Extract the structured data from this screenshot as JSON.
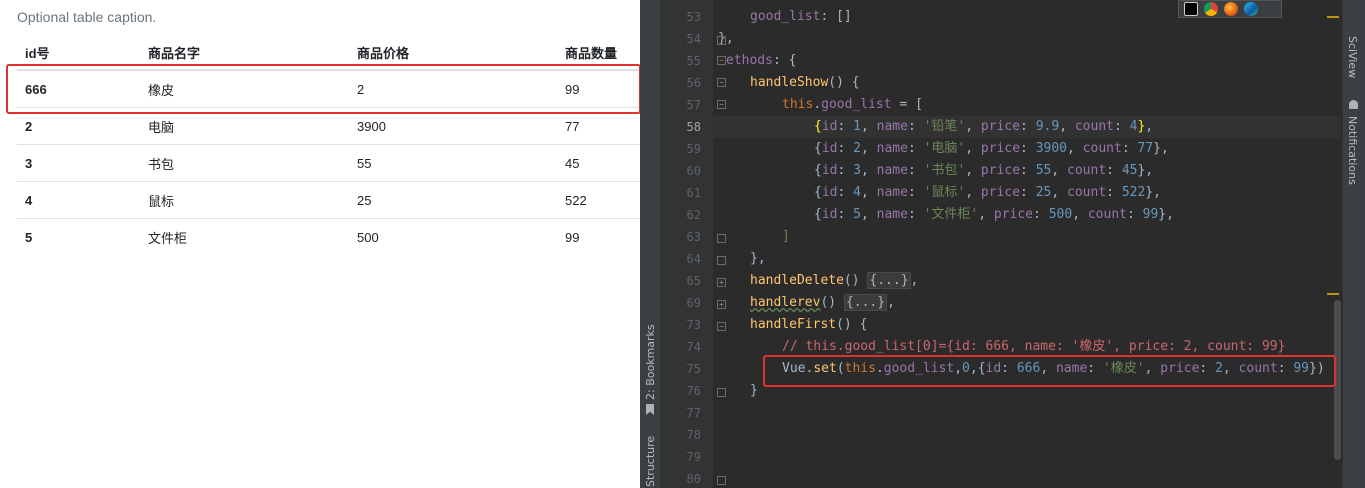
{
  "browser": {
    "caption": "Optional table caption.",
    "headers": [
      "id号",
      "商品名字",
      "商品价格",
      "商品数量"
    ],
    "rows": [
      {
        "id": "666",
        "name": "橡皮",
        "price": "2",
        "count": "99"
      },
      {
        "id": "2",
        "name": "电脑",
        "price": "3900",
        "count": "77"
      },
      {
        "id": "3",
        "name": "书包",
        "price": "55",
        "count": "45"
      },
      {
        "id": "4",
        "name": "鼠标",
        "price": "25",
        "count": "522"
      },
      {
        "id": "5",
        "name": "文件柜",
        "price": "500",
        "count": "99"
      }
    ]
  },
  "ide": {
    "left_tabs": {
      "bookmarks": "2: Bookmarks",
      "structure": "Structure"
    },
    "right_tabs": {
      "sciview": "SciView",
      "notifications": "Notifications"
    },
    "browser_icons": [
      "pycharm-icon",
      "chrome-icon",
      "firefox-icon",
      "edge-icon"
    ],
    "line_numbers": [
      "53",
      "54",
      "55",
      "56",
      "57",
      "58",
      "59",
      "60",
      "61",
      "62",
      "63",
      "64",
      "65",
      "69",
      "73",
      "74",
      "75",
      "76",
      "77",
      "78",
      "79",
      "80"
    ],
    "code": {
      "l53": [
        "good_list",
        ": []"
      ],
      "l54": [
        "},"
      ],
      "l55": [
        "ethods",
        ": {"
      ],
      "l56": [
        "handleShow",
        "() {"
      ],
      "l57": [
        "this",
        ".",
        "good_list",
        " = ["
      ],
      "items": [
        {
          "id": "1",
          "name": "'铅笔'",
          "price": "9.9",
          "count": "4"
        },
        {
          "id": "2",
          "name": "'电脑'",
          "price": "3900",
          "count": "77"
        },
        {
          "id": "3",
          "name": "'书包'",
          "price": "55",
          "count": "45"
        },
        {
          "id": "4",
          "name": "'鼠标'",
          "price": "25",
          "count": "522"
        },
        {
          "id": "5",
          "name": "'文件柜'",
          "price": "500",
          "count": "99"
        }
      ],
      "l63": [
        "]"
      ],
      "l64": [
        "},"
      ],
      "l65": [
        "handleDelete",
        "() ",
        "{...}",
        ","
      ],
      "l69": [
        "handlerev",
        "() ",
        "{...}",
        ","
      ],
      "l73": [
        "handleFirst",
        "() {"
      ],
      "l74": "// this.good_list[0]={id: 666, name: '橡皮', price: 2, count: 99}",
      "l75": {
        "obj": "Vue",
        "method": "set",
        "this": "this",
        "prop": "good_list",
        "idx": "0",
        "id": "666",
        "name": "'橡皮'",
        "price": "2",
        "count": "99"
      },
      "l76": [
        "}"
      ],
      "keys": {
        "id": "id",
        "name": "name",
        "price": "price",
        "count": "count"
      }
    }
  },
  "colors": {
    "highlight_box": "#e03131",
    "ide_bg": "#2b2b2b",
    "method": "#ffc66d",
    "keyword": "#cc7832",
    "number": "#6897bb",
    "string": "#6a8759",
    "property": "#9876aa"
  }
}
